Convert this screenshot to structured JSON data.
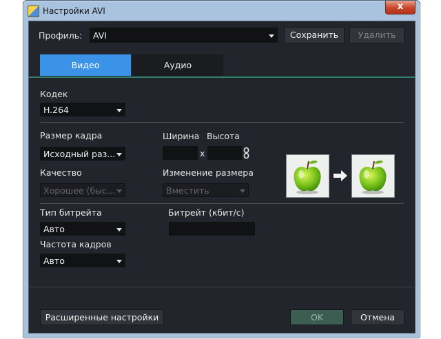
{
  "window": {
    "title": "Настройки AVI",
    "close_glyph": "x"
  },
  "profile": {
    "label": "Профиль:",
    "value": "AVI",
    "save_button": "Сохранить",
    "delete_button": "Удалить"
  },
  "tabs": [
    {
      "label": "Видео",
      "active": true
    },
    {
      "label": "Аудио",
      "active": false
    }
  ],
  "codec": {
    "label": "Кодек",
    "value": "H.264"
  },
  "frame": {
    "size_label": "Размер кадра",
    "size_value": "Исходный раз...",
    "width_label": "Ширина",
    "height_label": "Высота",
    "x_sep": "x",
    "width_value": "",
    "height_value": ""
  },
  "quality": {
    "label": "Качество",
    "value": "Хорошее (быс..."
  },
  "resize": {
    "label": "Изменение размера",
    "value": "Вместить"
  },
  "bitrate": {
    "type_label": "Тип битрейта",
    "type_value": "Авто",
    "value_label": "Битрейт (кбит/с)",
    "value": ""
  },
  "fps": {
    "label": "Частота кадров",
    "value": "Авто"
  },
  "footer": {
    "advanced_button": "Расширенные настройки",
    "ok_button": "OK",
    "cancel_button": "Отмена"
  },
  "colors": {
    "accent": "#3a93e6",
    "background": "#22252b",
    "ok": "#3c5e52"
  }
}
